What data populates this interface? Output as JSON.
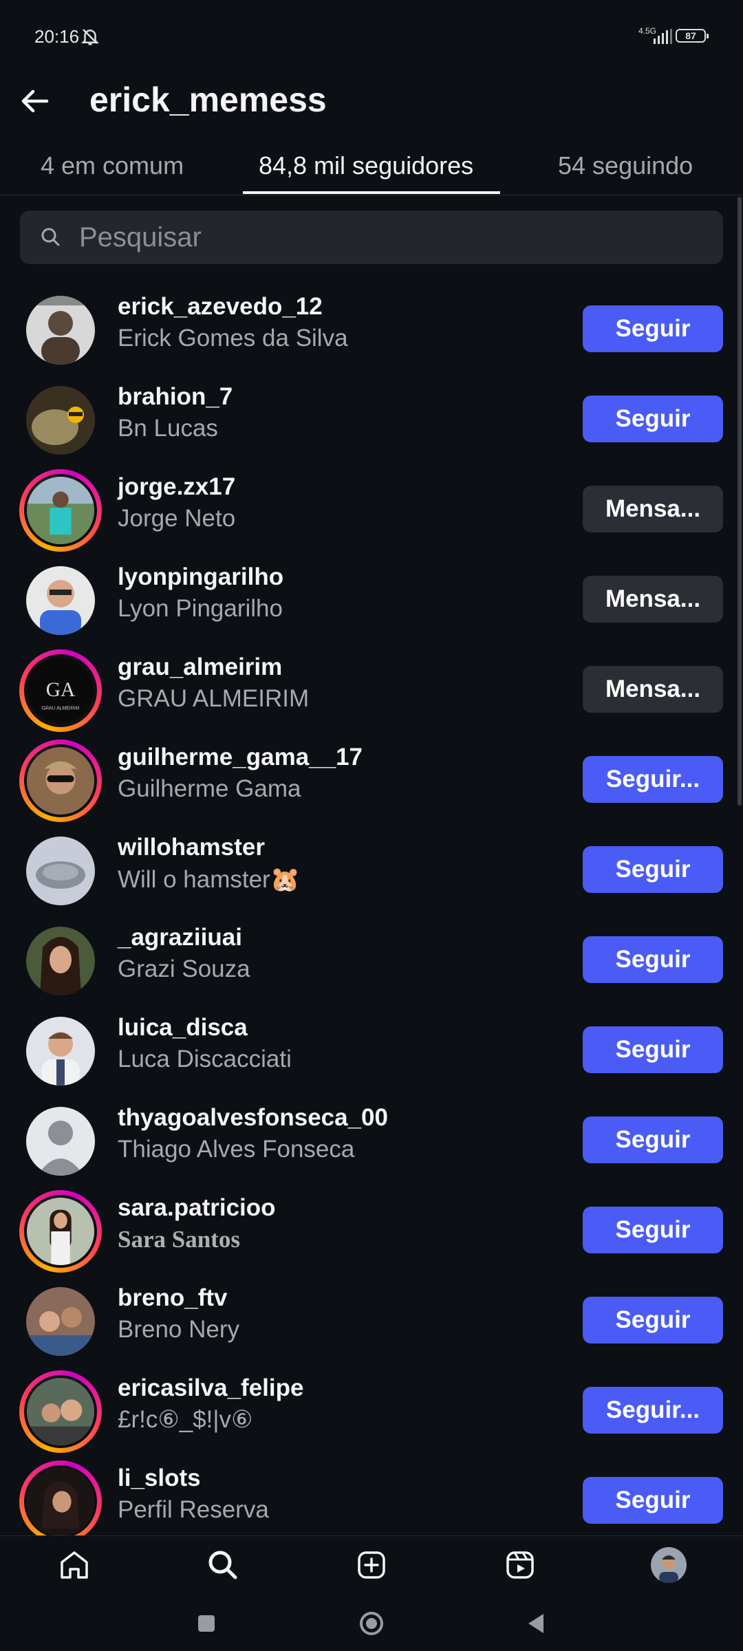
{
  "status": {
    "time": "20:16",
    "network": "4.5G",
    "battery": "87"
  },
  "header": {
    "title": "erick_memess"
  },
  "tabs": [
    {
      "label": "4 em comum"
    },
    {
      "label": "84,8 mil seguidores"
    },
    {
      "label": "54 seguindo"
    }
  ],
  "search": {
    "placeholder": "Pesquisar"
  },
  "accounts": [
    {
      "username": "erick_azevedo_12",
      "name": "Erick Gomes da Silva",
      "action": "Seguir"
    },
    {
      "username": "brahion_7",
      "name": "Bn Lucas",
      "action": "Seguir"
    },
    {
      "username": "jorge.zx17",
      "name": "Jorge Neto",
      "action": "Mensa..."
    },
    {
      "username": "lyonpingarilho",
      "name": "Lyon Pingarilho",
      "action": "Mensa..."
    },
    {
      "username": "grau_almeirim",
      "name": "GRAU ALMEIRIM",
      "action": "Mensa..."
    },
    {
      "username": "guilherme_gama__17",
      "name": "Guilherme Gama",
      "action": "Seguir..."
    },
    {
      "username": "willohamster",
      "name": "Will o hamster🐹",
      "action": "Seguir"
    },
    {
      "username": "_agraziiuai",
      "name": "Grazi Souza",
      "action": "Seguir"
    },
    {
      "username": "luica_disca",
      "name": "Luca Discacciati",
      "action": "Seguir"
    },
    {
      "username": "thyagoalvesfonseca_00",
      "name": "Thiago Alves Fonseca",
      "action": "Seguir"
    },
    {
      "username": "sara.patricioo",
      "name": "Sara Santos",
      "action": "Seguir"
    },
    {
      "username": "breno_ftv",
      "name": "Breno Nery",
      "action": "Seguir"
    },
    {
      "username": "ericasilva_felipe",
      "name": "£r!c⑥_$!|v⑥",
      "action": "Seguir..."
    },
    {
      "username": "li_slots",
      "name": "Perfil Reserva",
      "action": "Seguir"
    }
  ],
  "avatar_logo_text": "GRAU ALMEIRIM",
  "colors": {
    "background": "#0c0f14",
    "primary_button": "#4a5cf5",
    "secondary_button": "#2b2e34",
    "muted_text": "#a8a8ad"
  },
  "bottom_nav": [
    "home-icon",
    "search-icon",
    "create-icon",
    "reels-icon",
    "profile-avatar"
  ],
  "system_nav": [
    "recents-icon",
    "home-circle-icon",
    "back-triangle-icon"
  ]
}
